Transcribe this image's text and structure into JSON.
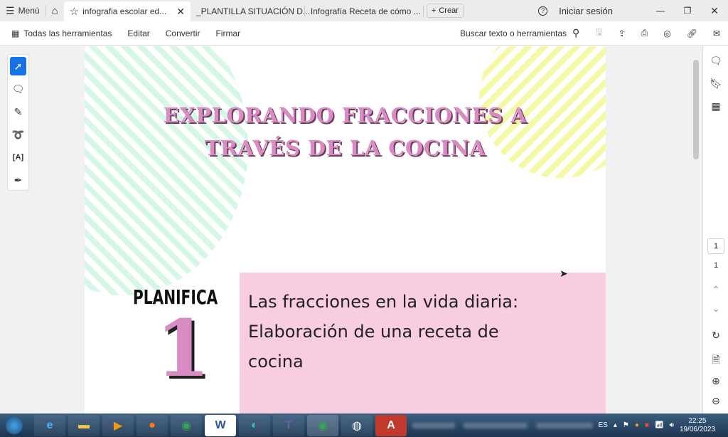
{
  "tabbar": {
    "menu": "Menú",
    "tabs": [
      {
        "label": "infografia escolar ed...",
        "active": true
      },
      {
        "label": "_PLANTILLA SITUACIÓN D..."
      },
      {
        "label": "Infografía Receta de cómo ..."
      }
    ],
    "create": "Crear",
    "signin": "Iniciar sesión"
  },
  "toolbar": {
    "all_tools": "Todas las herramientas",
    "edit": "Editar",
    "convert": "Convertir",
    "sign": "Firmar",
    "search": "Buscar texto o herramientas"
  },
  "document": {
    "title_line1": "EXPLORANDO FRACCIONES  A",
    "title_line2": "TRAVÉS DE LA COCINA",
    "step_label": "PLANIFICA",
    "step_number": "1",
    "box_lines": [
      "Las fracciones en la vida diaria:",
      "Elaboración de una receta de",
      "cocina"
    ]
  },
  "pagenav": {
    "current": "1",
    "total": "1"
  },
  "colors": {
    "accent": "#1473e6",
    "title_pink": "#d98cc4",
    "box_pink": "#f8cde2"
  },
  "taskbar": {
    "lang": "ES",
    "time": "22:25",
    "date": "19/06/2023"
  }
}
